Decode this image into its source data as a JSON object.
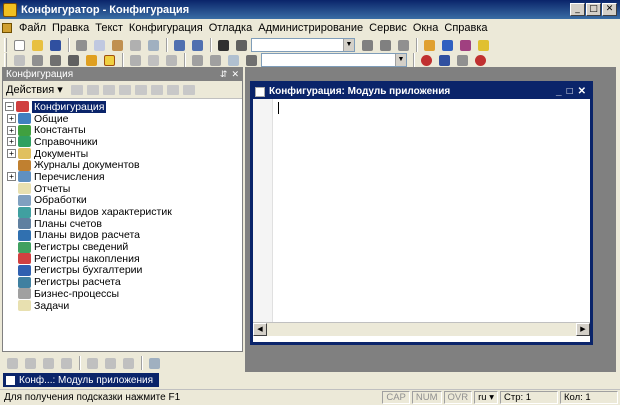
{
  "window": {
    "title": "Конфигуратор - Конфигурация"
  },
  "menu": [
    "Файл",
    "Правка",
    "Текст",
    "Конфигурация",
    "Отладка",
    "Администрирование",
    "Сервис",
    "Окна",
    "Справка"
  ],
  "config_panel": {
    "title": "Конфигурация",
    "actions_label": "Действия",
    "tree": [
      {
        "label": "Конфигурация",
        "expander": "minus",
        "selected": true,
        "icon_color": "#d04040"
      },
      {
        "label": "Общие",
        "expander": "plus",
        "icon_color": "#4080c0"
      },
      {
        "label": "Константы",
        "expander": "plus",
        "icon_color": "#40a040"
      },
      {
        "label": "Справочники",
        "expander": "plus",
        "icon_color": "#30a060"
      },
      {
        "label": "Документы",
        "expander": "plus",
        "icon_color": "#e0c060"
      },
      {
        "label": "Журналы документов",
        "expander": "none",
        "icon_color": "#c08030"
      },
      {
        "label": "Перечисления",
        "expander": "plus",
        "icon_color": "#6090c0"
      },
      {
        "label": "Отчеты",
        "expander": "none",
        "icon_color": "#e8e0b0"
      },
      {
        "label": "Обработки",
        "expander": "none",
        "icon_color": "#80a0c0"
      },
      {
        "label": "Планы видов характеристик",
        "expander": "none",
        "icon_color": "#40a0a0"
      },
      {
        "label": "Планы счетов",
        "expander": "none",
        "icon_color": "#6080a0"
      },
      {
        "label": "Планы видов расчета",
        "expander": "none",
        "icon_color": "#3070b0"
      },
      {
        "label": "Регистры сведений",
        "expander": "none",
        "icon_color": "#40a060"
      },
      {
        "label": "Регистры накопления",
        "expander": "none",
        "icon_color": "#d04040"
      },
      {
        "label": "Регистры бухгалтерии",
        "expander": "none",
        "icon_color": "#3060b0"
      },
      {
        "label": "Регистры расчета",
        "expander": "none",
        "icon_color": "#4080a0"
      },
      {
        "label": "Бизнес-процессы",
        "expander": "none",
        "icon_color": "#a0a0a0"
      },
      {
        "label": "Задачи",
        "expander": "none",
        "icon_color": "#e8e0b0"
      }
    ]
  },
  "child_window": {
    "title": "Конфигурация: Модуль приложения"
  },
  "taskbar": {
    "item": "Конф...: Модуль приложения"
  },
  "status": {
    "message": "Для получения подсказки нажмите F1",
    "cap": "CAP",
    "num": "NUM",
    "ovr": "OVR",
    "lang": "ru",
    "row": "Стр: 1",
    "col": "Кол: 1"
  },
  "colors": {
    "titlebar": "#0a246a",
    "selection": "#0a246a",
    "mdi_background": "#808080"
  }
}
